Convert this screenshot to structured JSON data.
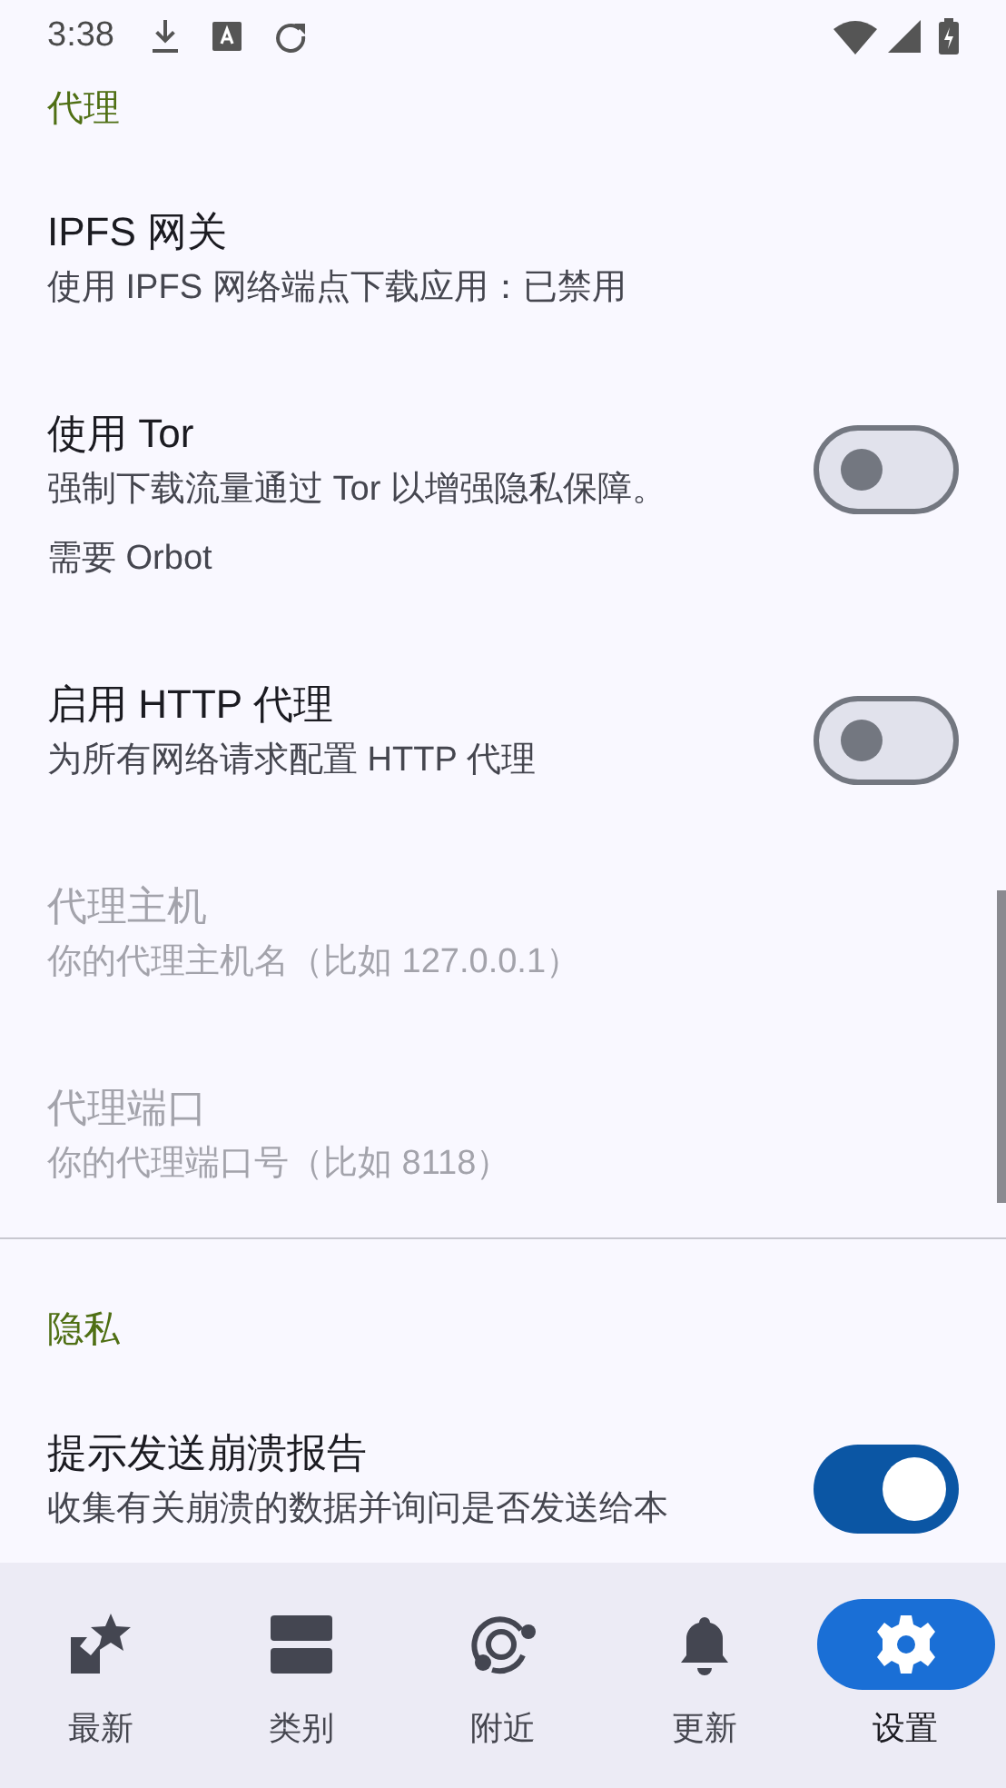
{
  "status_bar": {
    "time": "3:38"
  },
  "sections": [
    {
      "header": "代理",
      "items": [
        {
          "kind": "plain",
          "title": "IPFS 网关",
          "summary": [
            "使用 IPFS 网络端点下载应用：已禁用"
          ],
          "disabled": false
        },
        {
          "kind": "switch",
          "title": "使用 Tor",
          "summary": [
            "强制下载流量通过 Tor 以增强隐私保障。",
            "需要 Orbot"
          ],
          "disabled": false,
          "on": false
        },
        {
          "kind": "switch",
          "title": "启用 HTTP 代理",
          "summary": [
            "为所有网络请求配置 HTTP 代理"
          ],
          "disabled": false,
          "on": false
        },
        {
          "kind": "plain",
          "title": "代理主机",
          "summary": [
            "你的代理主机名（比如 127.0.0.1）"
          ],
          "disabled": true
        },
        {
          "kind": "plain",
          "title": "代理端口",
          "summary": [
            "你的代理端口号（比如 8118）"
          ],
          "disabled": true
        }
      ]
    },
    {
      "header": "隐私",
      "items": [
        {
          "kind": "switch",
          "title": "提示发送崩溃报告",
          "summary": [
            "收集有关崩溃的数据并询问是否发送给本"
          ],
          "disabled": false,
          "on": true
        }
      ]
    }
  ],
  "nav": [
    {
      "label": "最新",
      "selected": false
    },
    {
      "label": "类别",
      "selected": false
    },
    {
      "label": "附近",
      "selected": false
    },
    {
      "label": "更新",
      "selected": false
    },
    {
      "label": "设置",
      "selected": true
    }
  ]
}
